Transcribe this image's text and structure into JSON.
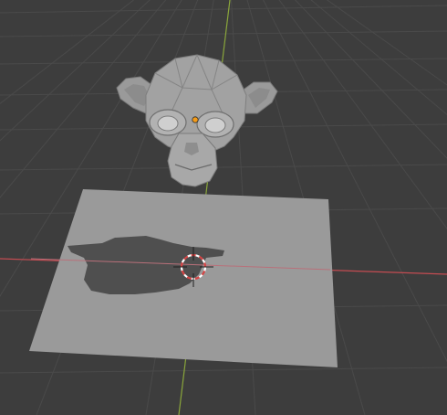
{
  "app": "3D Viewport",
  "scene": {
    "objects": [
      {
        "name": "monkey-head",
        "type": "mesh",
        "selected": false
      },
      {
        "name": "plane",
        "type": "mesh",
        "selected": false
      }
    ],
    "has_3d_cursor": true,
    "has_origin_marker": true,
    "grid": true,
    "axes": {
      "x_color": "#c44c52",
      "y_color": "#8aa63b"
    }
  },
  "colors": {
    "background": "#3d3d3d",
    "grid_line": "#4a4a4a",
    "mesh_light": "#9a9a9a",
    "mesh_shadow": "#4f4f4f",
    "origin_marker": "#f39b1a"
  }
}
